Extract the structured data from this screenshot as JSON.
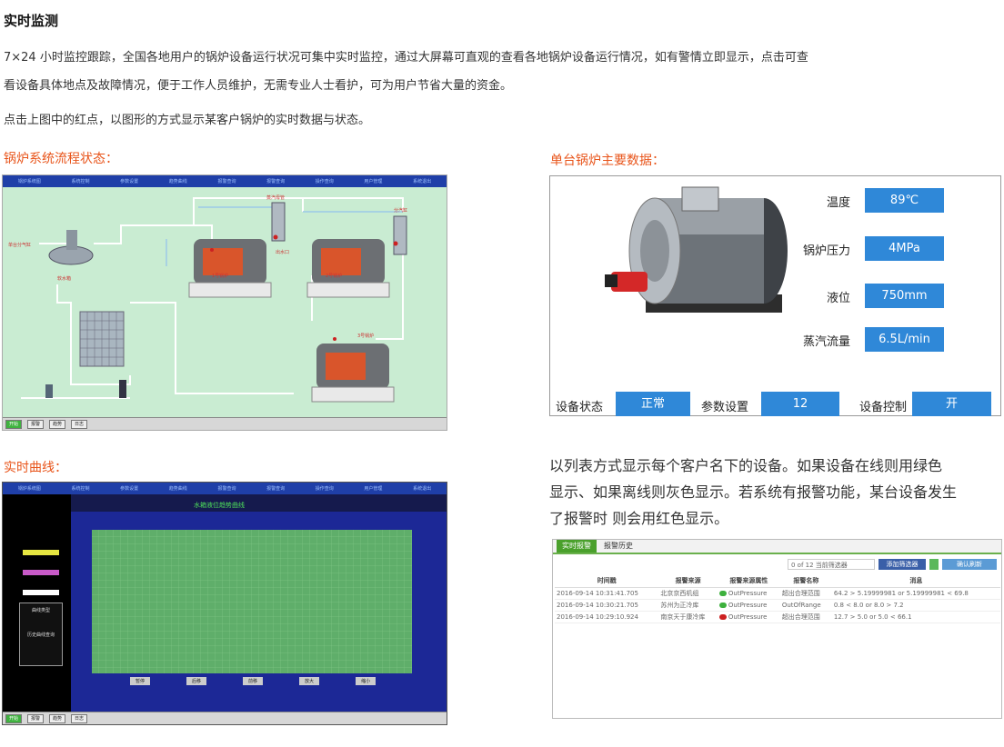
{
  "heading": "实时监测",
  "paragraph1_line1": "7×24 小时监控跟踪，全国各地用户的锅炉设备运行状况可集中实时监控，通过大屏幕可直观的查看各地锅炉设备运行情况，如有警情立即显示，点击可查",
  "paragraph1_line2": "看设备具体地点及故障情况，便于工作人员维护，无需专业人士看护，可为用户节省大量的资金。",
  "paragraph2": "点击上图中的红点，以图形的方式显示某客户锅炉的实时数据与状态。",
  "sections": {
    "flow": "锅炉系统流程状态：",
    "boiler": "单台锅炉主要数据：",
    "curve": "实时曲线："
  },
  "flow_panel": {
    "nav": [
      "锅炉系统图",
      "系统控制",
      "参数设置",
      "趋势曲线",
      "报警查询",
      "报警查询",
      "操作查询",
      "用户管理",
      "系统退出"
    ],
    "labels": [
      "软水箱",
      "蒸汽母管",
      "1号锅炉",
      "2号锅炉",
      "3号锅炉",
      "分汽缸",
      "出水口"
    ],
    "bottom": [
      "开始",
      "报警",
      "趋势",
      "日志"
    ]
  },
  "boiler_panel": {
    "metrics": [
      {
        "label": "温度",
        "value": "89℃"
      },
      {
        "label": "锅炉压力",
        "value": "4MPa"
      },
      {
        "label": "液位",
        "value": "750mm"
      },
      {
        "label": "蒸汽流量",
        "value": "6.5L/min"
      }
    ],
    "status": {
      "label": "设备状态",
      "value": "正常"
    },
    "param": {
      "label": "参数设置",
      "value": "12"
    },
    "control": {
      "label": "设备控制",
      "value": "开"
    }
  },
  "curve_panel": {
    "nav": [
      "锅炉系统图",
      "系统控制",
      "参数设置",
      "趋势曲线",
      "报警查询",
      "报警查询",
      "操作查询",
      "用户管理",
      "系统退出"
    ],
    "title": "水箱液位趋势曲线",
    "left_box_title": "曲线类型",
    "left_box_title2": "历史曲线查询",
    "buttons": [
      "暂停",
      "后移",
      "前移",
      "放大",
      "缩小"
    ],
    "bottom": [
      "开始",
      "报警",
      "趋势",
      "日志"
    ]
  },
  "alarm_desc": {
    "line1": "以列表方式显示每个客户名下的设备。如果设备在线则用绿色",
    "line2": "显示、如果离线则灰色显示。若系统有报警功能，某台设备发生",
    "line3": "了报警时 则会用红色显示。"
  },
  "alarm_panel": {
    "tab_active": "实时报警",
    "tab_other": "报警历史",
    "filter_text": "0 of 12 当前筛选器",
    "add_filter": "添加筛选器",
    "confirm": "确认刷新",
    "columns": [
      "时间戳",
      "报警来源",
      "报警来源属性",
      "报警名称",
      "消息"
    ],
    "rows": [
      {
        "time": "2016-09-14 10:31:41.705",
        "source": "北京京西机组",
        "attr": "OutPressure",
        "name": "超出合理范围",
        "msg": "64.2 > 5.19999981 or 5.19999981 < 69.8",
        "color": "#3db03d"
      },
      {
        "time": "2016-09-14 10:30:21.705",
        "source": "苏州为正冷库",
        "attr": "OutPressure",
        "name": "OutOfRange",
        "msg": "0.8 < 8.0 or 8.0 > 7.2",
        "color": "#3db03d"
      },
      {
        "time": "2016-09-14 10:29:10.924",
        "source": "南京天于康冷库",
        "attr": "OutPressure",
        "name": "超出合理范围",
        "msg": "12.7 > 5.0 or 5.0 < 66.1",
        "color": "#cc1f1f"
      }
    ]
  }
}
